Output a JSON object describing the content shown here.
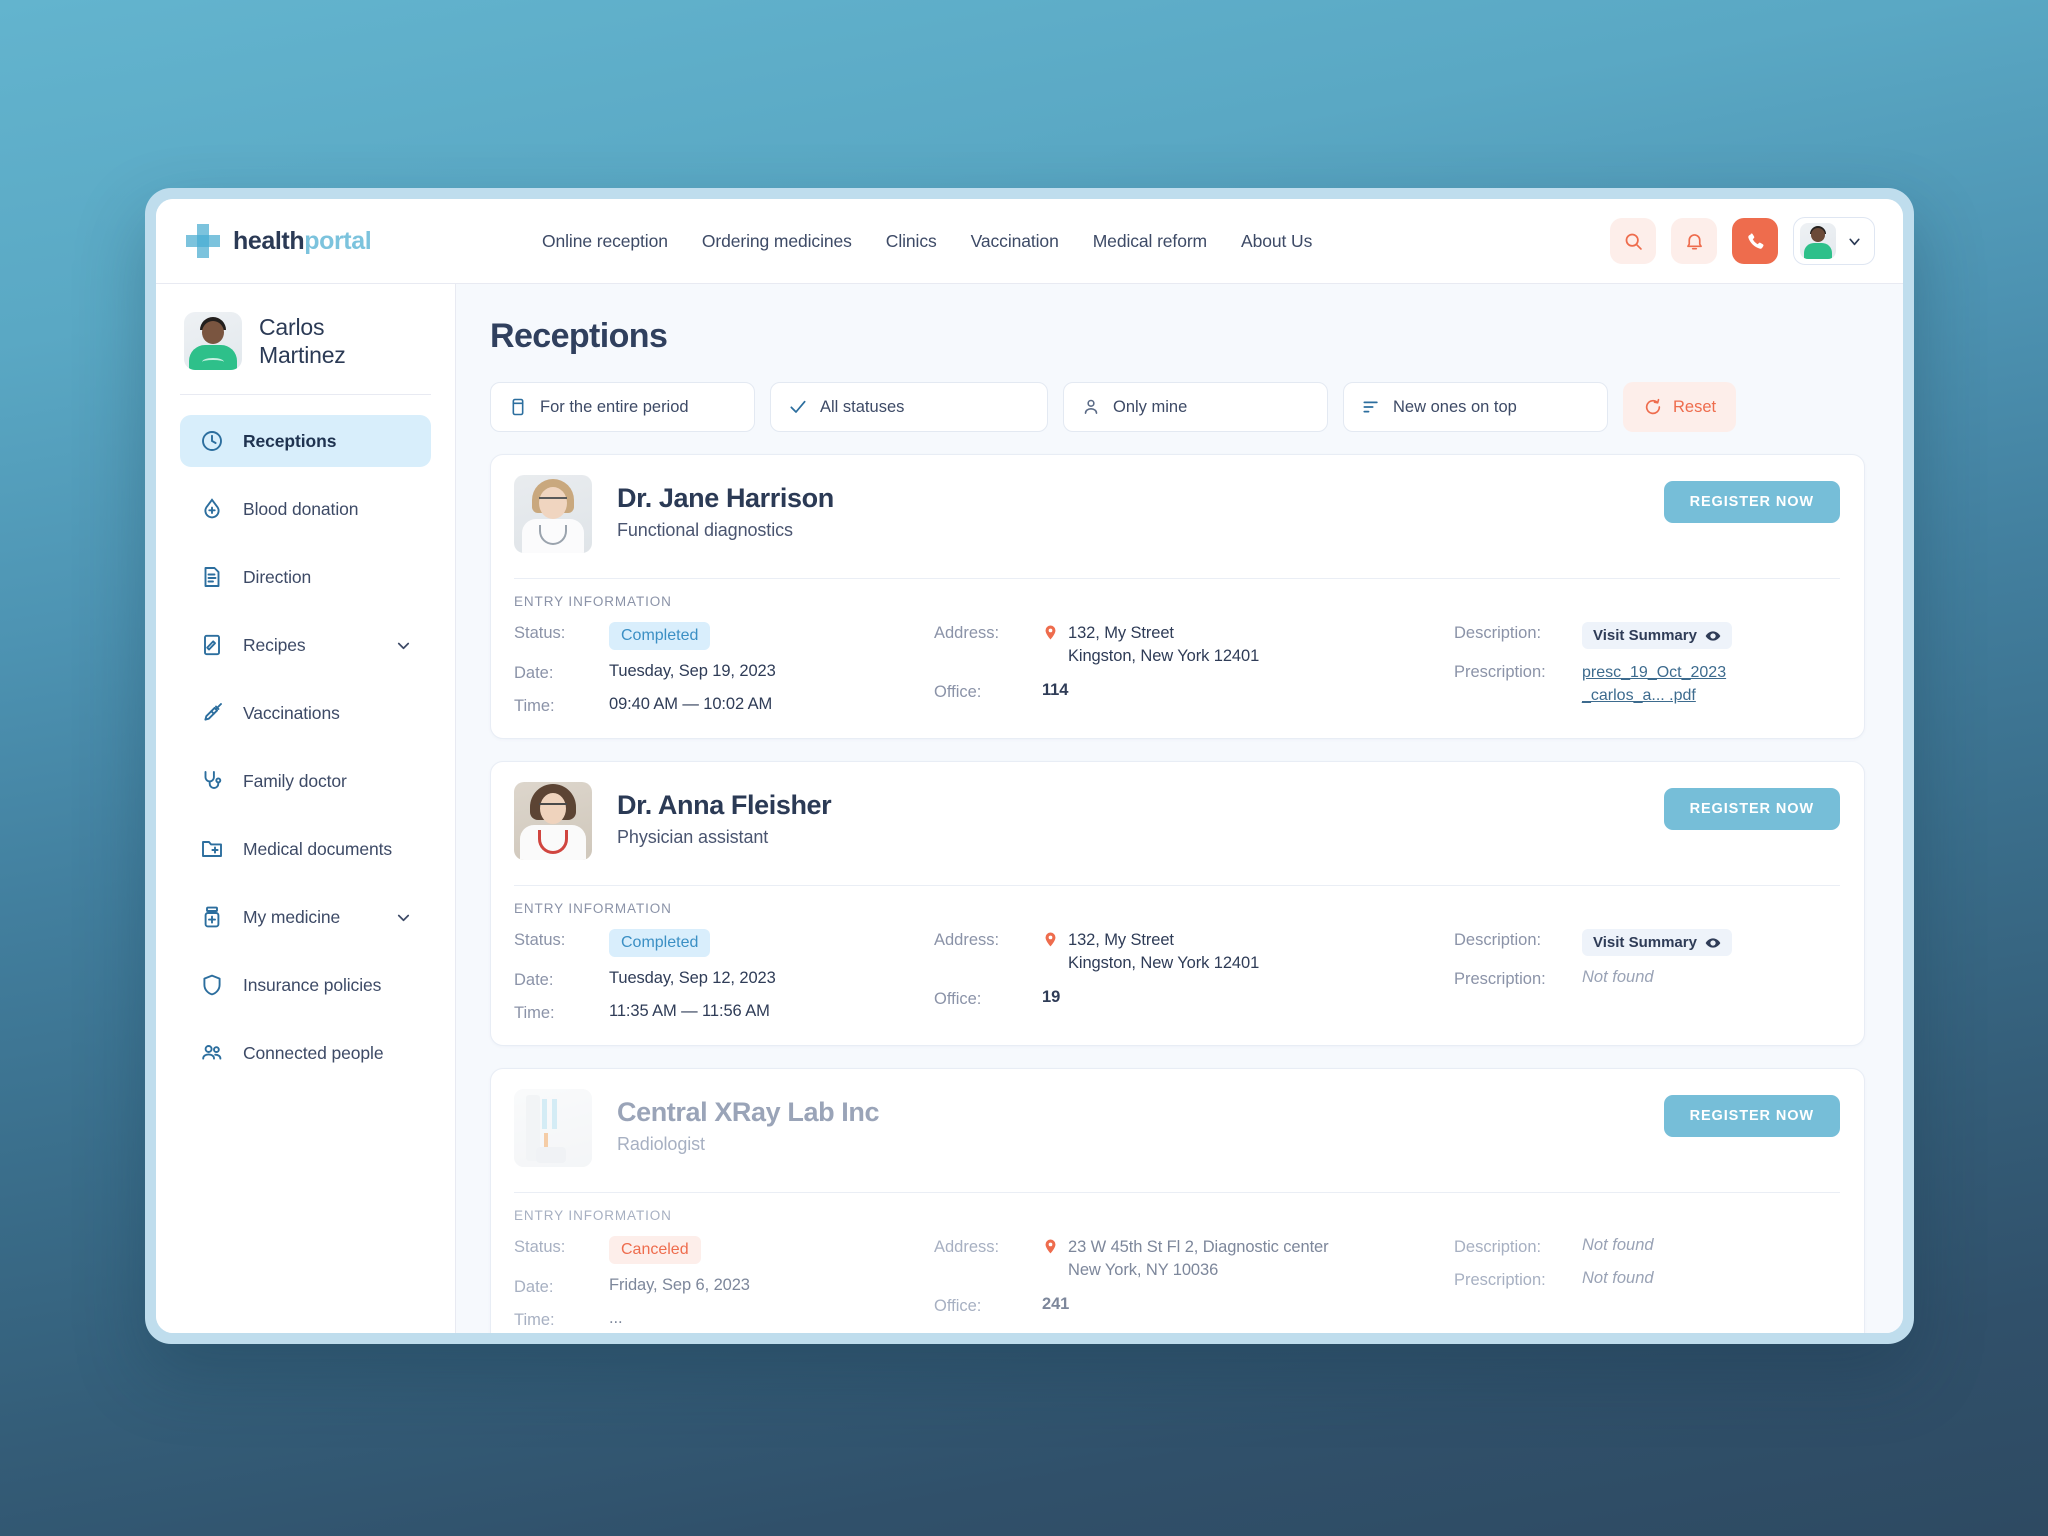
{
  "brand": {
    "part1": "health",
    "part2": "portal"
  },
  "nav": {
    "links": [
      {
        "label": "Online reception"
      },
      {
        "label": "Ordering medicines"
      },
      {
        "label": "Clinics"
      },
      {
        "label": "Vaccination"
      },
      {
        "label": "Medical reform"
      },
      {
        "label": "About Us"
      }
    ],
    "actions": [
      {
        "name": "search-icon"
      },
      {
        "name": "bell-icon"
      },
      {
        "name": "phone-icon"
      }
    ]
  },
  "sidebar": {
    "profile": {
      "first_name": "Carlos",
      "last_name": "Martinez"
    },
    "items": [
      {
        "label": "Receptions",
        "icon": "clock-icon",
        "active": true,
        "expandable": false
      },
      {
        "label": "Blood donation",
        "icon": "blood-drop-icon",
        "active": false,
        "expandable": false
      },
      {
        "label": "Direction",
        "icon": "document-icon",
        "active": false,
        "expandable": false
      },
      {
        "label": "Recipes",
        "icon": "prescription-icon",
        "active": false,
        "expandable": true
      },
      {
        "label": "Vaccinations",
        "icon": "syringe-icon",
        "active": false,
        "expandable": false
      },
      {
        "label": "Family doctor",
        "icon": "stethoscope-icon",
        "active": false,
        "expandable": false
      },
      {
        "label": "Medical documents",
        "icon": "folder-plus-icon",
        "active": false,
        "expandable": false
      },
      {
        "label": "My medicine",
        "icon": "medicine-bottle-icon",
        "active": false,
        "expandable": true
      },
      {
        "label": "Insurance policies",
        "icon": "shield-icon",
        "active": false,
        "expandable": false
      },
      {
        "label": "Connected people",
        "icon": "people-icon",
        "active": false,
        "expandable": false
      }
    ]
  },
  "main": {
    "title": "Receptions",
    "filters": [
      {
        "label": "For the entire period",
        "icon": "calendar-icon"
      },
      {
        "label": "All statuses",
        "icon": "check-icon"
      },
      {
        "label": "Only mine",
        "icon": "person-icon"
      },
      {
        "label": "New ones on top",
        "icon": "sort-icon"
      }
    ],
    "reset": {
      "label": "Reset",
      "icon": "refresh-icon"
    },
    "entry_information_label": "ENTRY INFORMATION",
    "labels": {
      "status": "Status:",
      "date": "Date:",
      "time": "Time:",
      "address": "Address:",
      "office": "Office:",
      "description": "Description:",
      "prescription": "Prescription:"
    },
    "register_label": "REGISTER NOW",
    "cards": [
      {
        "name": "Dr. Jane Harrison",
        "role": "Functional diagnostics",
        "muted": false,
        "status": "Completed",
        "status_kind": "completed",
        "date": "Tuesday, Sep 19, 2023",
        "time": "09:40 AM — 10:02 AM",
        "address_line1": "132, My Street",
        "address_line2": "Kingston, New York 12401",
        "office": "114",
        "description": "Visit Summary",
        "description_kind": "pill",
        "prescription": "presc_19_Oct_2023_carlos_a... .pdf",
        "prescription_kind": "link"
      },
      {
        "name": "Dr. Anna Fleisher",
        "role": "Physician assistant",
        "muted": false,
        "status": "Completed",
        "status_kind": "completed",
        "date": "Tuesday, Sep 12, 2023",
        "time": "11:35 AM — 11:56 AM",
        "address_line1": "132, My Street",
        "address_line2": "Kingston, New York 12401",
        "office": "19",
        "description": "Visit Summary",
        "description_kind": "pill",
        "prescription": "Not found",
        "prescription_kind": "notfound"
      },
      {
        "name": "Central XRay Lab Inc",
        "role": "Radiologist",
        "muted": true,
        "status": "Canceled",
        "status_kind": "canceled",
        "date": "Friday, Sep 6, 2023",
        "time": "...",
        "address_line1": "23 W 45th St Fl 2, Diagnostic center",
        "address_line2": "New York, NY 10036",
        "office": "241",
        "description": "Not found",
        "description_kind": "notfound",
        "prescription": "Not found",
        "prescription_kind": "notfound"
      }
    ]
  },
  "colors": {
    "accent_coral": "#ee6c4d",
    "accent_blue": "#76bed8",
    "brand_light": "#7cc3dd",
    "text_dark": "#2b3a55"
  }
}
